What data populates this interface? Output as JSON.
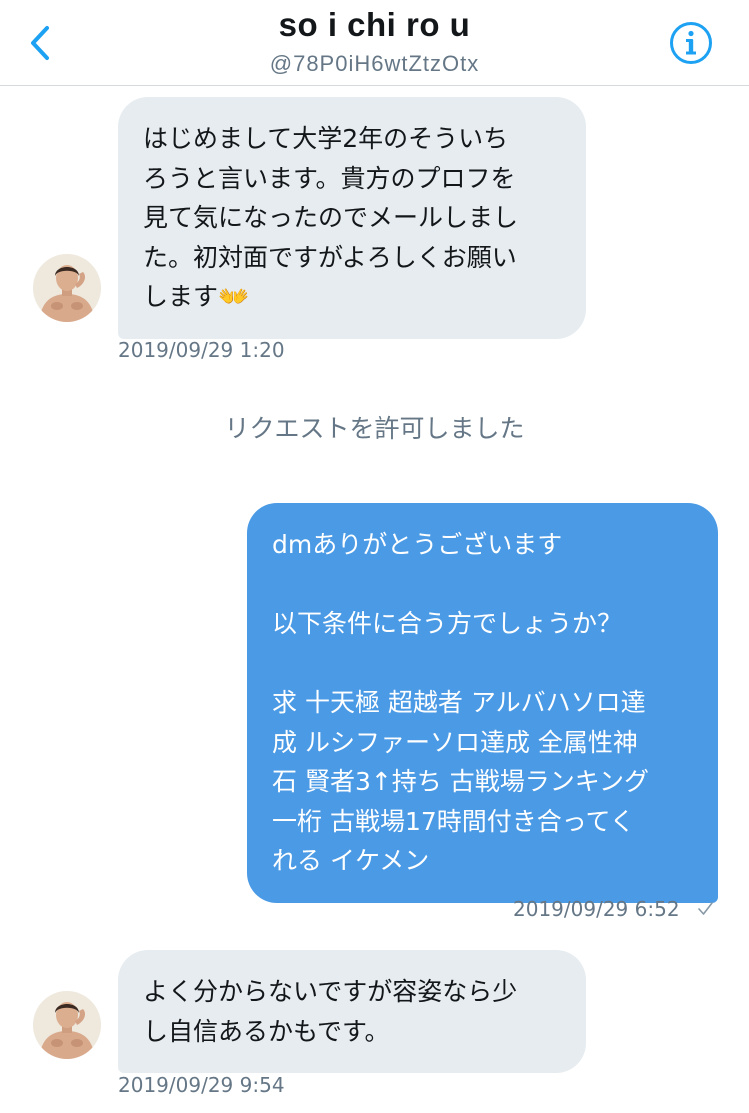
{
  "header": {
    "title": "so i chi ro u",
    "handle": "@78P0iH6wtZtzOtx",
    "back_icon": "chevron-left-icon",
    "info_icon": "info-icon",
    "accent_color": "#1da1f2"
  },
  "messages": [
    {
      "direction": "incoming",
      "lines": [
        "はじめまして大学2年のそういち",
        "ろうと言います。貴方のプロフを",
        "見て気になったのでメールしまし",
        "た。初対面ですがよろしくお願い",
        "します👐"
      ],
      "timestamp": "2019/09/29 1:20"
    },
    {
      "direction": "outgoing",
      "lines": [
        "dmありがとうございます",
        "",
        "以下条件に合う方でしょうか？",
        "",
        "求 十天極 超越者 アルバハソロ達",
        "成 ルシファーソロ達成 全属性神",
        "石 賢者3↑持ち 古戦場ランキング",
        "一桁 古戦場17時間付き合ってく",
        "れる イケメン"
      ],
      "timestamp": "2019/09/29 6:52",
      "status_icon": "check-icon"
    },
    {
      "direction": "incoming",
      "lines": [
        "よく分からないですが容姿なら少",
        "し自信あるかもです。"
      ],
      "timestamp": "2019/09/29 9:54"
    }
  ],
  "system_message": "リクエストを許可しました",
  "colors": {
    "incoming_bubble": "#e6ecf0",
    "outgoing_bubble": "#4a9ae5",
    "timestamp": "#657786"
  }
}
